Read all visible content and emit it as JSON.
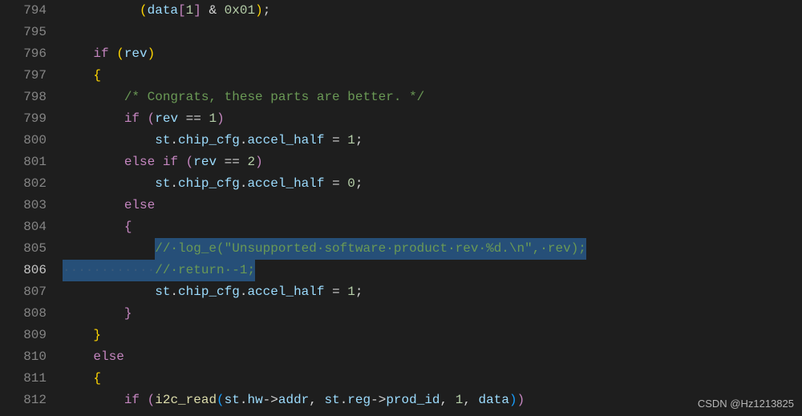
{
  "watermark_right": "CSDN @Hz1213825",
  "watermark_left": "",
  "gutter": {
    "start": 794,
    "end": 812
  },
  "code_lines": [
    {
      "n": 794,
      "tokens": [
        {
          "t": "          ",
          "c": "txt"
        },
        {
          "t": "(",
          "c": "paren"
        },
        {
          "t": "data",
          "c": "var"
        },
        {
          "t": "[",
          "c": "paren2"
        },
        {
          "t": "1",
          "c": "num"
        },
        {
          "t": "]",
          "c": "paren2"
        },
        {
          "t": " & ",
          "c": "op"
        },
        {
          "t": "0x01",
          "c": "num"
        },
        {
          "t": ")",
          "c": "paren"
        },
        {
          "t": ";",
          "c": "txt"
        }
      ]
    },
    {
      "n": 795,
      "tokens": []
    },
    {
      "n": 796,
      "tokens": [
        {
          "t": "    ",
          "c": "txt"
        },
        {
          "t": "if",
          "c": "kw"
        },
        {
          "t": " ",
          "c": "txt"
        },
        {
          "t": "(",
          "c": "paren"
        },
        {
          "t": "rev",
          "c": "var"
        },
        {
          "t": ")",
          "c": "paren"
        }
      ]
    },
    {
      "n": 797,
      "tokens": [
        {
          "t": "    ",
          "c": "txt"
        },
        {
          "t": "{",
          "c": "paren"
        }
      ]
    },
    {
      "n": 798,
      "tokens": [
        {
          "t": "        ",
          "c": "txt"
        },
        {
          "t": "/* Congrats, these parts are better. */",
          "c": "cmt"
        }
      ]
    },
    {
      "n": 799,
      "tokens": [
        {
          "t": "        ",
          "c": "txt"
        },
        {
          "t": "if",
          "c": "kw"
        },
        {
          "t": " ",
          "c": "txt"
        },
        {
          "t": "(",
          "c": "paren2"
        },
        {
          "t": "rev",
          "c": "var"
        },
        {
          "t": " == ",
          "c": "op"
        },
        {
          "t": "1",
          "c": "num"
        },
        {
          "t": ")",
          "c": "paren2"
        }
      ]
    },
    {
      "n": 800,
      "tokens": [
        {
          "t": "            ",
          "c": "txt"
        },
        {
          "t": "st",
          "c": "var"
        },
        {
          "t": ".",
          "c": "txt"
        },
        {
          "t": "chip_cfg",
          "c": "prop"
        },
        {
          "t": ".",
          "c": "txt"
        },
        {
          "t": "accel_half",
          "c": "prop"
        },
        {
          "t": " = ",
          "c": "op"
        },
        {
          "t": "1",
          "c": "num"
        },
        {
          "t": ";",
          "c": "txt"
        }
      ]
    },
    {
      "n": 801,
      "tokens": [
        {
          "t": "        ",
          "c": "txt"
        },
        {
          "t": "else",
          "c": "kw"
        },
        {
          "t": " ",
          "c": "txt"
        },
        {
          "t": "if",
          "c": "kw"
        },
        {
          "t": " ",
          "c": "txt"
        },
        {
          "t": "(",
          "c": "paren2"
        },
        {
          "t": "rev",
          "c": "var"
        },
        {
          "t": " == ",
          "c": "op"
        },
        {
          "t": "2",
          "c": "num"
        },
        {
          "t": ")",
          "c": "paren2"
        }
      ]
    },
    {
      "n": 802,
      "tokens": [
        {
          "t": "            ",
          "c": "txt"
        },
        {
          "t": "st",
          "c": "var"
        },
        {
          "t": ".",
          "c": "txt"
        },
        {
          "t": "chip_cfg",
          "c": "prop"
        },
        {
          "t": ".",
          "c": "txt"
        },
        {
          "t": "accel_half",
          "c": "prop"
        },
        {
          "t": " = ",
          "c": "op"
        },
        {
          "t": "0",
          "c": "num"
        },
        {
          "t": ";",
          "c": "txt"
        }
      ]
    },
    {
      "n": 803,
      "tokens": [
        {
          "t": "        ",
          "c": "txt"
        },
        {
          "t": "else",
          "c": "kw"
        }
      ]
    },
    {
      "n": 804,
      "tokens": [
        {
          "t": "        ",
          "c": "txt"
        },
        {
          "t": "{",
          "c": "paren2"
        }
      ]
    },
    {
      "n": 805,
      "selected": true,
      "sel_from": 12,
      "tokens": [
        {
          "t": "            ",
          "c": "txt"
        },
        {
          "t": "// log_e(\"Unsupported software product rev %d.\\n\", rev);",
          "c": "cmt"
        }
      ]
    },
    {
      "n": 806,
      "selected": true,
      "sel_full_prefix": true,
      "tokens": [
        {
          "t": "            ",
          "c": "txt"
        },
        {
          "t": "// return -1;",
          "c": "cmt"
        }
      ]
    },
    {
      "n": 807,
      "tokens": [
        {
          "t": "            ",
          "c": "txt"
        },
        {
          "t": "st",
          "c": "var"
        },
        {
          "t": ".",
          "c": "txt"
        },
        {
          "t": "chip_cfg",
          "c": "prop"
        },
        {
          "t": ".",
          "c": "txt"
        },
        {
          "t": "accel_half",
          "c": "prop"
        },
        {
          "t": " = ",
          "c": "op"
        },
        {
          "t": "1",
          "c": "num"
        },
        {
          "t": ";",
          "c": "txt"
        }
      ]
    },
    {
      "n": 808,
      "tokens": [
        {
          "t": "        ",
          "c": "txt"
        },
        {
          "t": "}",
          "c": "paren2"
        }
      ]
    },
    {
      "n": 809,
      "tokens": [
        {
          "t": "    ",
          "c": "txt"
        },
        {
          "t": "}",
          "c": "paren"
        }
      ]
    },
    {
      "n": 810,
      "tokens": [
        {
          "t": "    ",
          "c": "txt"
        },
        {
          "t": "else",
          "c": "kw"
        }
      ]
    },
    {
      "n": 811,
      "tokens": [
        {
          "t": "    ",
          "c": "txt"
        },
        {
          "t": "{",
          "c": "paren"
        }
      ]
    },
    {
      "n": 812,
      "tokens": [
        {
          "t": "        ",
          "c": "txt"
        },
        {
          "t": "if",
          "c": "kw"
        },
        {
          "t": " ",
          "c": "txt"
        },
        {
          "t": "(",
          "c": "paren2"
        },
        {
          "t": "i2c_read",
          "c": "fn"
        },
        {
          "t": "(",
          "c": "paren3"
        },
        {
          "t": "st",
          "c": "var"
        },
        {
          "t": ".",
          "c": "txt"
        },
        {
          "t": "hw",
          "c": "prop"
        },
        {
          "t": "->",
          "c": "op"
        },
        {
          "t": "addr",
          "c": "prop"
        },
        {
          "t": ", ",
          "c": "txt"
        },
        {
          "t": "st",
          "c": "var"
        },
        {
          "t": ".",
          "c": "txt"
        },
        {
          "t": "reg",
          "c": "prop"
        },
        {
          "t": "->",
          "c": "op"
        },
        {
          "t": "prod_id",
          "c": "prop"
        },
        {
          "t": ", ",
          "c": "txt"
        },
        {
          "t": "1",
          "c": "num"
        },
        {
          "t": ", ",
          "c": "txt"
        },
        {
          "t": "data",
          "c": "var"
        },
        {
          "t": ")",
          "c": "paren3"
        },
        {
          "t": ")",
          "c": "paren2"
        }
      ]
    }
  ]
}
